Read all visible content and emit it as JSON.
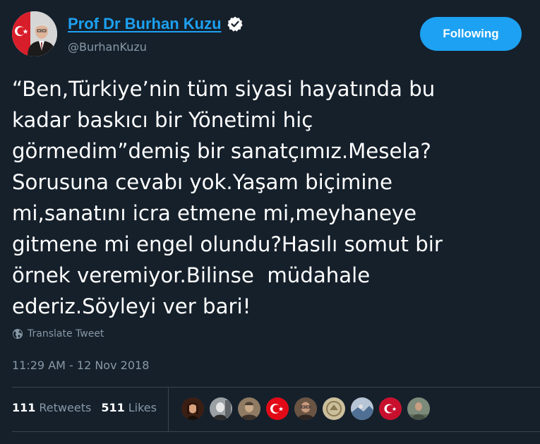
{
  "author": {
    "name": "Prof Dr Burhan Kuzu",
    "handle": "@BurhanKuzu",
    "verified_icon": "verified-badge-icon"
  },
  "follow_button": {
    "label": "Following",
    "color": "#1da1f2"
  },
  "tweet": {
    "text": "“Ben,Türkiye’nin tüm siyasi hayatında bu\nkadar baskıcı bir Yönetimi hiç\ngörmedim”demiş bir sanatçımız.Mesela?\nSorusuna cevabı yok.Yaşam biçimine\nmi,sanatını icra etmene mi,meyhaneye\ngitmene mi engel olundu?Hasılı somut bir\nörnek veremiyor.Bilinse  müdahale\nederiz.Söyleyi ver bari!",
    "translate_label": "Translate Tweet",
    "translate_icon": "globe-icon",
    "timestamp": "11:29 AM - 12 Nov 2018"
  },
  "stats": {
    "retweets_count": "111",
    "retweets_label": "Retweets",
    "likes_count": "511",
    "likes_label": "Likes"
  },
  "likers": [
    {
      "icon": "liker-avatar-woman-dark-hair"
    },
    {
      "icon": "liker-avatar-man-gray"
    },
    {
      "icon": "liker-avatar-man-sepia"
    },
    {
      "icon": "liker-avatar-turkish-flag"
    },
    {
      "icon": "liker-avatar-man-glasses"
    },
    {
      "icon": "liker-avatar-emblem-beige"
    },
    {
      "icon": "liker-avatar-landscape-blue"
    },
    {
      "icon": "liker-avatar-turkish-flag-crescent"
    },
    {
      "icon": "liker-avatar-man-outdoor"
    }
  ],
  "colors": {
    "background": "#15202b",
    "accent": "#1da1f2",
    "secondary_text": "#8899a6",
    "divider": "#38444d"
  }
}
